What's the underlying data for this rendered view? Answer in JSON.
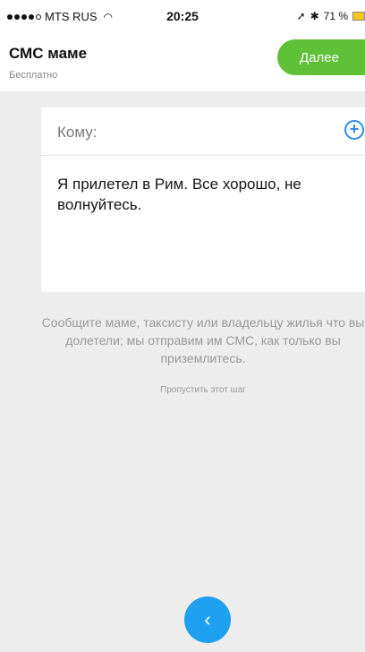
{
  "status_bar": {
    "carrier": "MTS RUS",
    "time": "20:25",
    "battery": "71 %"
  },
  "header": {
    "title": "СМС маме",
    "subtitle": "Бесплатно",
    "next_label": "Далее"
  },
  "form": {
    "to_label": "Кому:",
    "message": "Я прилетел в Рим. Все хорошо, не волнуйтесь."
  },
  "hint": "Сообщите маме, таксисту или владельцу жилья что вы долетели; мы отправим им СМС, как только вы приземлитесь.",
  "skip_label": "Пропустить этот шаг",
  "back_label": "‹",
  "colors": {
    "accent_green": "#5ec137",
    "accent_blue": "#1ea0f0",
    "add_icon_blue": "#2d8ce8"
  },
  "icons": [
    "signal-icon",
    "wifi-icon",
    "location-icon",
    "bluetooth-icon",
    "battery-icon",
    "add-icon",
    "back-icon"
  ]
}
